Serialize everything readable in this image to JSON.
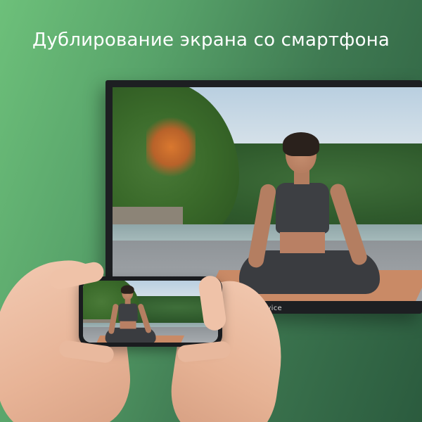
{
  "headline": "Дублирование экрана со смартфона",
  "tv": {
    "brand": "topdevice"
  },
  "colors": {
    "background_start": "#6dc07a",
    "background_end": "#2b5b3e",
    "text": "#ffffff",
    "tv_frame": "#1d1f22"
  }
}
